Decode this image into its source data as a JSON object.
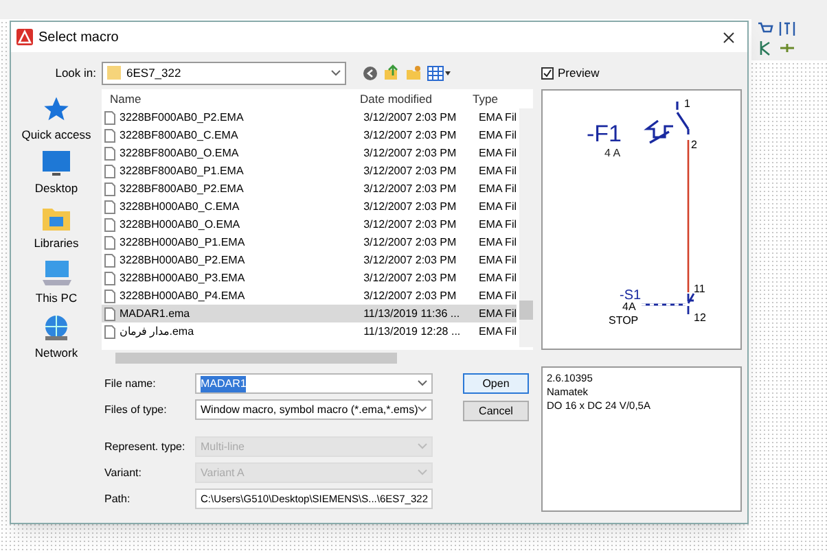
{
  "dialog": {
    "title": "Select macro",
    "look_in_label": "Look in:",
    "look_in_value": "6ES7_322",
    "columns": [
      "Name",
      "Date modified",
      "Type"
    ],
    "places": [
      "Quick access",
      "Desktop",
      "Libraries",
      "This PC",
      "Network"
    ],
    "files": [
      {
        "name": "3228BF000AB0_P2.EMA",
        "date": "3/12/2007 2:03 PM",
        "type": "EMA Fil",
        "selected": false
      },
      {
        "name": "3228BF800AB0_C.EMA",
        "date": "3/12/2007 2:03 PM",
        "type": "EMA Fil",
        "selected": false
      },
      {
        "name": "3228BF800AB0_O.EMA",
        "date": "3/12/2007 2:03 PM",
        "type": "EMA Fil",
        "selected": false
      },
      {
        "name": "3228BF800AB0_P1.EMA",
        "date": "3/12/2007 2:03 PM",
        "type": "EMA Fil",
        "selected": false
      },
      {
        "name": "3228BF800AB0_P2.EMA",
        "date": "3/12/2007 2:03 PM",
        "type": "EMA Fil",
        "selected": false
      },
      {
        "name": "3228BH000AB0_C.EMA",
        "date": "3/12/2007 2:03 PM",
        "type": "EMA Fil",
        "selected": false
      },
      {
        "name": "3228BH000AB0_O.EMA",
        "date": "3/12/2007 2:03 PM",
        "type": "EMA Fil",
        "selected": false
      },
      {
        "name": "3228BH000AB0_P1.EMA",
        "date": "3/12/2007 2:03 PM",
        "type": "EMA Fil",
        "selected": false
      },
      {
        "name": "3228BH000AB0_P2.EMA",
        "date": "3/12/2007 2:03 PM",
        "type": "EMA Fil",
        "selected": false
      },
      {
        "name": "3228BH000AB0_P3.EMA",
        "date": "3/12/2007 2:03 PM",
        "type": "EMA Fil",
        "selected": false
      },
      {
        "name": "3228BH000AB0_P4.EMA",
        "date": "3/12/2007 2:03 PM",
        "type": "EMA Fil",
        "selected": false
      },
      {
        "name": "MADAR1.ema",
        "date": "11/13/2019 11:36 ...",
        "type": "EMA Fil",
        "selected": true
      },
      {
        "name": "مدار فرمان.ema",
        "date": "11/13/2019 12:28 ...",
        "type": "EMA Fil",
        "selected": false
      }
    ],
    "fields": [
      {
        "label": "File name:",
        "value": "MADAR1",
        "disabled": false
      },
      {
        "label": "Files of type:",
        "value": "Window macro, symbol macro (*.ema,*.ems)",
        "disabled": false
      },
      {
        "label": "Represent. type:",
        "value": "Multi-line",
        "disabled": true
      },
      {
        "label": "Variant:",
        "value": "Variant A",
        "disabled": true
      }
    ],
    "path_label": "Path:",
    "path_value": "C:\\Users\\G510\\Desktop\\SIEMENS\\S...\\6ES7_322",
    "buttons": [
      "Open",
      "Cancel"
    ],
    "preview": {
      "label": "Preview",
      "checked": true,
      "f1": "-F1",
      "f1_rating": "4 A",
      "t1": "1",
      "t2": "2",
      "s1": "-S1",
      "s1_rating": "4A",
      "s1_note": "STOP",
      "t11": "11",
      "t12": "12"
    },
    "info": [
      "2.6.10395",
      "Namatek",
      "DO 16 x DC 24 V/0,5A"
    ]
  }
}
